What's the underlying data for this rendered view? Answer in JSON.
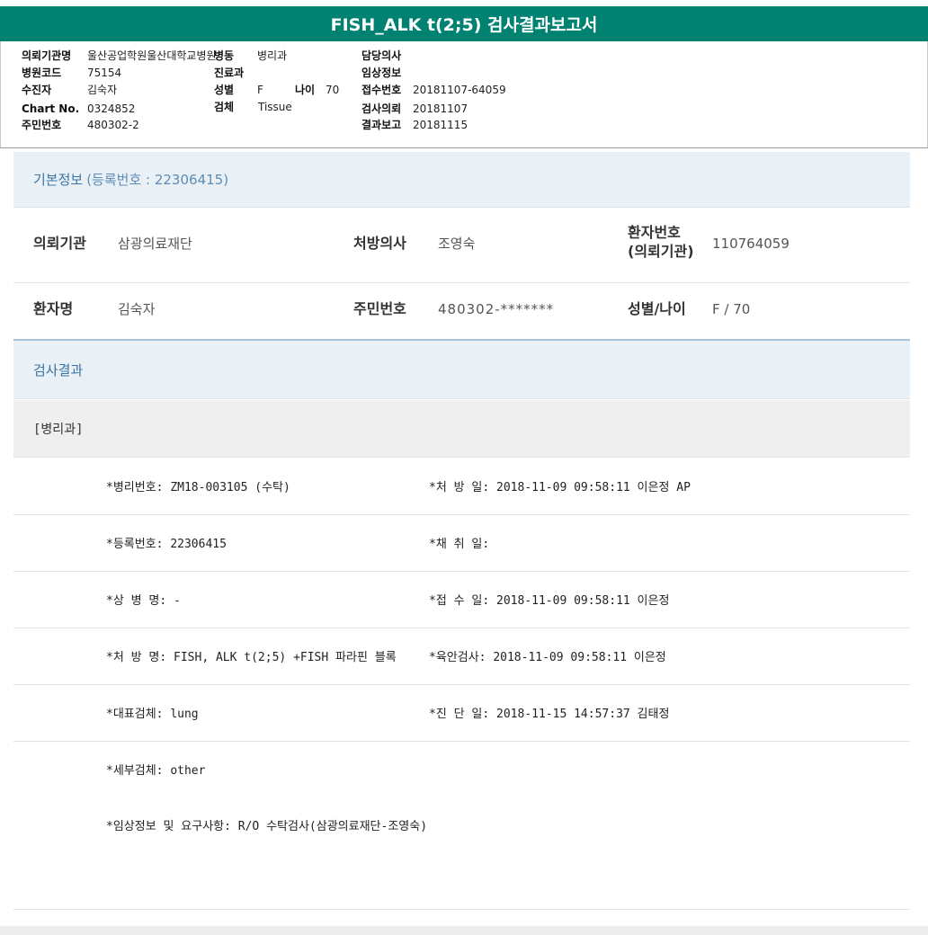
{
  "title": "FISH_ALK t(2;5) 검사결과보고서",
  "header": {
    "left": [
      {
        "label": "의뢰기관명",
        "value": "울산공업학원울산대학교병원"
      },
      {
        "label": "병원코드",
        "value": "75154"
      },
      {
        "label": "수진자",
        "value": "김숙자"
      },
      {
        "label": "Chart No.",
        "value": "0324852"
      },
      {
        "label": "주민번호",
        "value": "480302-2"
      }
    ],
    "mid": {
      "ward_label": "병동",
      "ward_value": "병리과",
      "dept_label": "진료과",
      "dept_value": "",
      "sex_label": "성별",
      "sex_value": "F",
      "age_label": "나이",
      "age_value": "70",
      "specimen_label": "검체",
      "specimen_value": "Tissue"
    },
    "right": [
      {
        "label": "담당의사",
        "value": ""
      },
      {
        "label": "임상정보",
        "value": ""
      },
      {
        "label": "접수번호",
        "value": "20181107-64059"
      },
      {
        "label": "검사의뢰",
        "value": "20181107"
      },
      {
        "label": "결과보고",
        "value": "20181115"
      }
    ]
  },
  "basic": {
    "title": "기본정보",
    "reg_text": "(등록번호 : 22306415)",
    "row1": {
      "inst_label": "의뢰기관",
      "inst_value": "삼광의료재단",
      "doctor_label": "처방의사",
      "doctor_value": "조영숙",
      "pid_label_1": "환자번호",
      "pid_label_2": "(의뢰기관)",
      "pid_value": "110764059"
    },
    "row2": {
      "name_label": "환자명",
      "name_value": "김숙자",
      "rrn_label": "주민번호",
      "rrn_value": "480302-*******",
      "sexage_label": "성별/나이",
      "sexage_value": "F / 70"
    }
  },
  "results": {
    "title": "검사결과",
    "dept": "[병리과]",
    "rows": [
      {
        "left": "*병리번호: ZM18-003105 (수탁)",
        "right": "*처 방 일: 2018-11-09 09:58:11  이은정 AP"
      },
      {
        "left": "*등록번호: 22306415",
        "right": "*채 취 일:"
      },
      {
        "left": "*상 병 명: -",
        "right": "*접 수 일: 2018-11-09 09:58:11  이은정"
      },
      {
        "left": "*처 방 명: FISH, ALK t(2;5) +FISH 파라핀 블록",
        "right": "*육안검사: 2018-11-09 09:58:11  이은정"
      },
      {
        "left": "*대표검체: lung",
        "right": "*진 단 일: 2018-11-15 14:57:37  김태정"
      },
      {
        "left": "*세부검체: other",
        "right": ""
      },
      {
        "left": "*임상정보 및 요구사항: R/O 수탁검사(삼광의료재단-조영숙)",
        "right": ""
      }
    ]
  }
}
